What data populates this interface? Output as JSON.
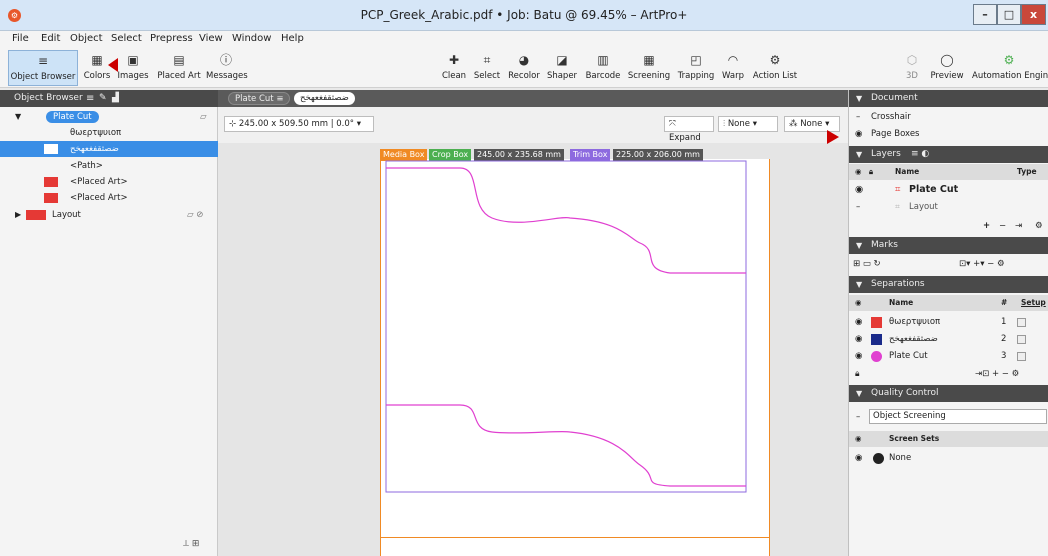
{
  "window": {
    "title": "PCP_Greek_Arabic.pdf • Job: Batu @ 69.45% – ArtPro+",
    "app_icon": "⚙",
    "min": "–",
    "max": "□",
    "close": "x"
  },
  "menu": [
    "File",
    "Edit",
    "Object",
    "Select",
    "Prepress",
    "View",
    "Window",
    "Help"
  ],
  "toolbar_left": [
    {
      "label": "Object Browser",
      "icon": "object-browser-icon",
      "glyph": "≡"
    },
    {
      "label": "Colors",
      "icon": "colors-icon",
      "glyph": "▦"
    },
    {
      "label": "Images",
      "icon": "images-icon",
      "glyph": "▣"
    },
    {
      "label": "Placed Art",
      "icon": "placed-art-icon",
      "glyph": "▤"
    },
    {
      "label": "Messages",
      "icon": "info-icon",
      "glyph": "ⓘ"
    }
  ],
  "toolbar_mid": [
    {
      "label": "Clean",
      "icon": "clean-icon",
      "glyph": "✚"
    },
    {
      "label": "Select",
      "icon": "select-icon",
      "glyph": "⌗"
    },
    {
      "label": "Recolor",
      "icon": "recolor-icon",
      "glyph": "◕"
    },
    {
      "label": "Shaper",
      "icon": "shaper-icon",
      "glyph": "◪"
    },
    {
      "label": "Barcode",
      "icon": "barcode-icon",
      "glyph": "▥"
    },
    {
      "label": "Screening",
      "icon": "screening-icon",
      "glyph": "▦"
    },
    {
      "label": "Trapping",
      "icon": "trapping-icon",
      "glyph": "◰"
    },
    {
      "label": "Warp",
      "icon": "warp-icon",
      "glyph": "◠"
    },
    {
      "label": "Action List",
      "icon": "action-list-icon",
      "glyph": "⚙"
    }
  ],
  "toolbar_right": [
    {
      "label": "3D",
      "icon": "3d-icon",
      "glyph": "⬡"
    },
    {
      "label": "Preview",
      "icon": "preview-icon",
      "glyph": "◯"
    },
    {
      "label": "Automation Engine",
      "icon": "automation-engine-icon",
      "glyph": "⚙"
    }
  ],
  "left_panel": {
    "header": "Object Browser",
    "rows": [
      {
        "label": "Plate Cut",
        "type": "layer"
      },
      {
        "label": "θωερτψυιοπ",
        "type": "text"
      },
      {
        "label": "ضصثقفغعهخح",
        "type": "text-selected"
      },
      {
        "label": "<Path>",
        "type": "path"
      },
      {
        "label": "<Placed Art>",
        "type": "art"
      },
      {
        "label": "<Placed Art>",
        "type": "art"
      },
      {
        "label": "Layout",
        "type": "layer2"
      }
    ]
  },
  "tabs": {
    "doc": "Plate Cut",
    "active": "ضصثقفغعهخح"
  },
  "controls": {
    "dimensions": "245.00 x 509.50 mm | 0.0°",
    "expand": "Expand",
    "none1": "None",
    "none2": "None"
  },
  "boxes": {
    "media": "Media Box",
    "crop": "Crop Box",
    "crop_size": "245.00 x 235.68 mm",
    "trim": "Trim Box",
    "trim_size": "225.00 x 206.00 mm"
  },
  "right_panel": {
    "document": "Document",
    "crosshair": "Crosshair",
    "page_boxes": "Page Boxes",
    "layers": "Layers",
    "layers_cols": {
      "name": "Name",
      "type": "Type"
    },
    "layers_rows": [
      "Plate Cut",
      "Layout"
    ],
    "marks": "Marks",
    "separations": "Separations",
    "sep_cols": {
      "name": "Name",
      "num": "#",
      "setup": "Setup"
    },
    "sep_rows": [
      {
        "name": "θωερτψυιοπ",
        "num": "1",
        "color": "#e53935"
      },
      {
        "name": "ضصثقفغعهخح",
        "num": "2",
        "color": "#1a2a8a"
      },
      {
        "name": "Plate Cut",
        "num": "3",
        "color": "#e040d0"
      }
    ],
    "quality_control": "Quality Control",
    "qc_select": "Object Screening",
    "screen_sets": "Screen Sets",
    "screen_none": "None"
  }
}
